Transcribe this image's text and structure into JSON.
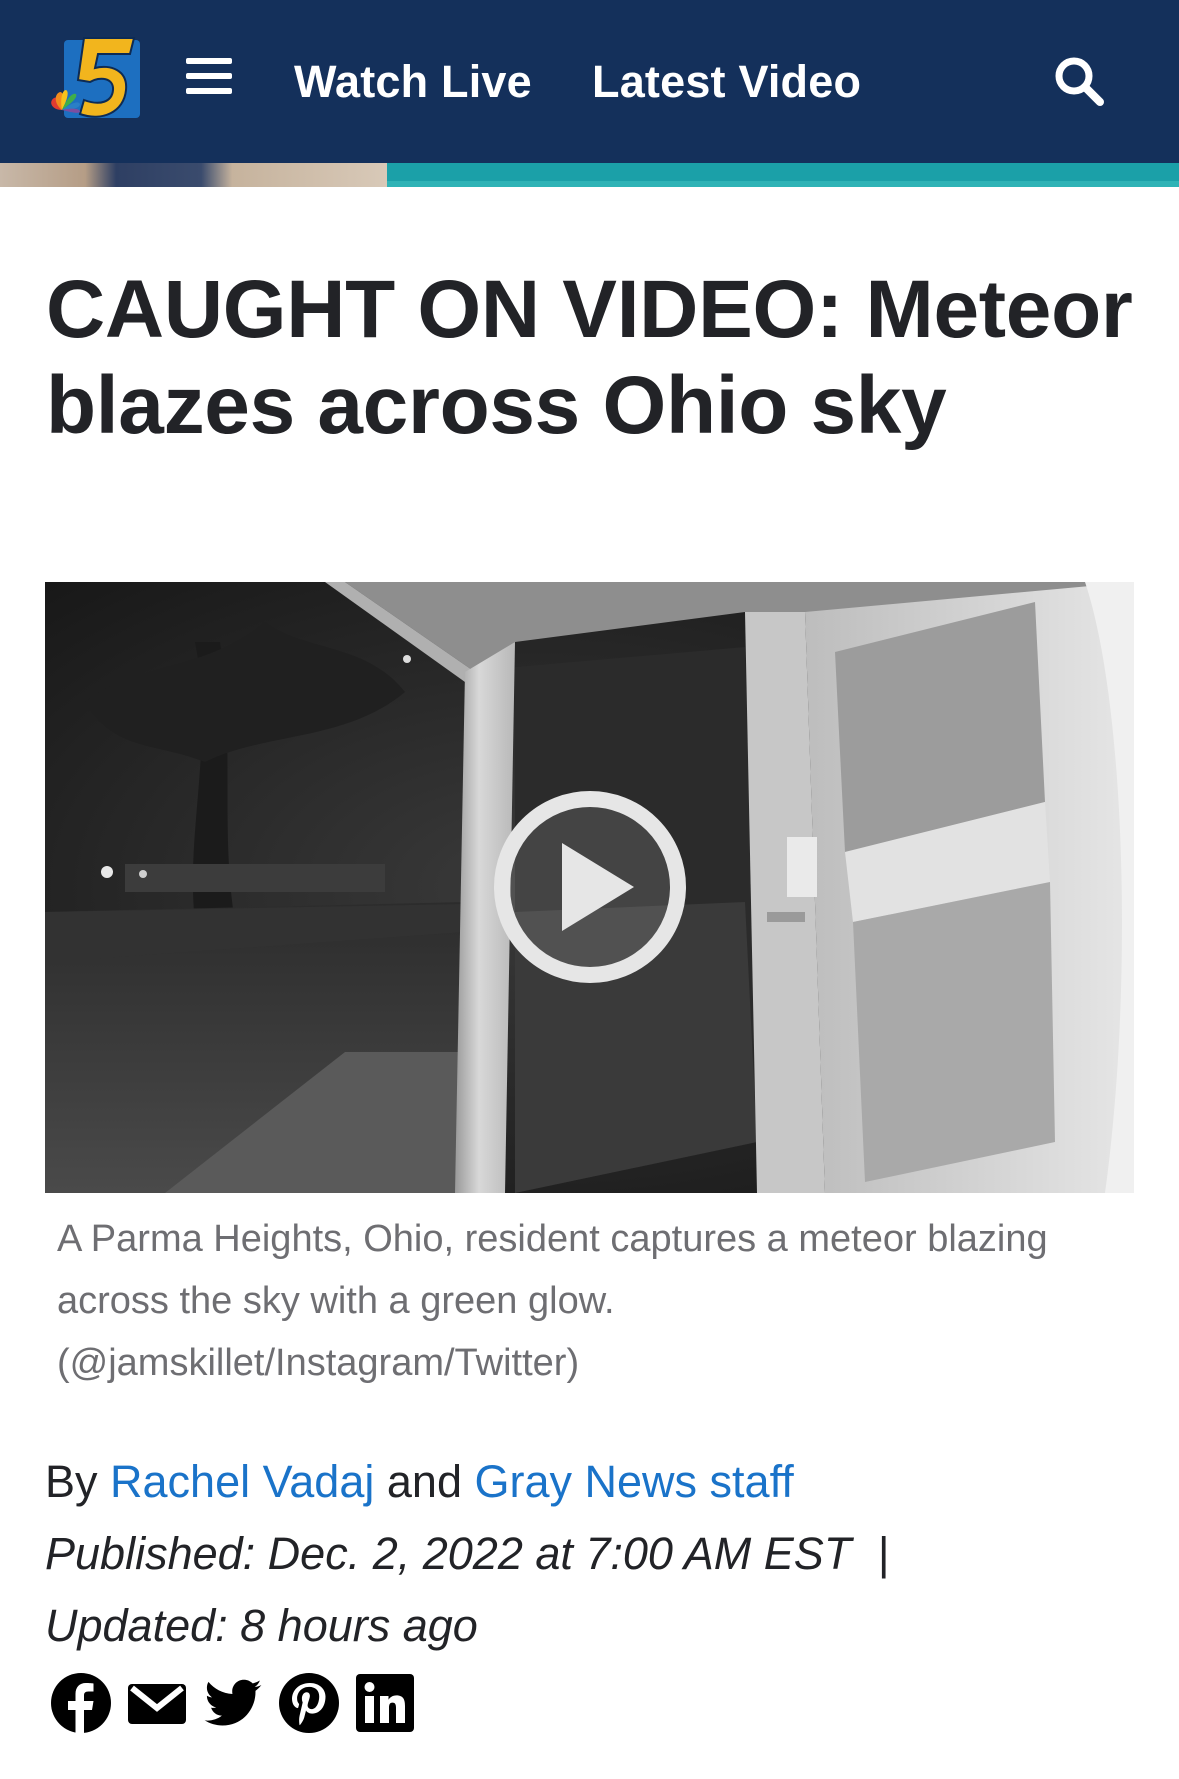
{
  "header": {
    "logo_icon": "nbc-5-logo-icon",
    "menu_icon": "hamburger-menu-icon",
    "nav": [
      {
        "label": "Watch Live"
      },
      {
        "label": "Latest Video"
      }
    ],
    "search_icon": "search-icon",
    "background_color": "#14305b"
  },
  "article": {
    "headline": "CAUGHT ON VIDEO: Meteor blazes across Ohio sky",
    "video": {
      "play_icon": "play-icon"
    },
    "caption": "A Parma Heights, Ohio, resident captures a meteor blazing across the sky with a green glow. (@jamskillet/Instagram/Twitter)",
    "byline": {
      "prefix": "By",
      "author_1": "Rachel Vadaj",
      "joiner": "and",
      "author_2": "Gray News staff"
    },
    "published_label": "Published:",
    "published_value": "Dec. 2, 2022 at 7:00 AM EST",
    "separator": "|",
    "updated_label": "Updated:",
    "updated_value": "8 hours ago",
    "link_color": "#1a73c9"
  },
  "share": [
    {
      "icon": "facebook-icon"
    },
    {
      "icon": "email-icon"
    },
    {
      "icon": "twitter-icon"
    },
    {
      "icon": "pinterest-icon"
    },
    {
      "icon": "linkedin-icon"
    }
  ]
}
